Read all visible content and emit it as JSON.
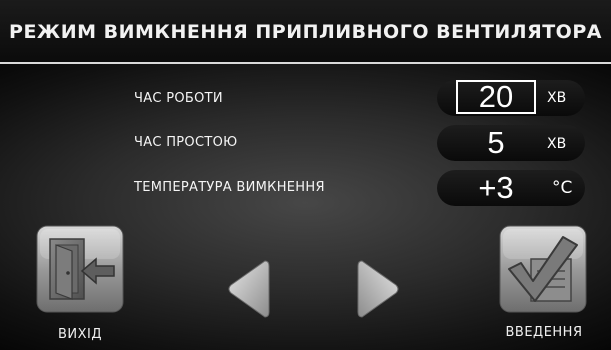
{
  "header": {
    "title": "РЕЖИМ ВИМКНЕННЯ ПРИПЛИВНОГО ВЕНТИЛЯТОРА"
  },
  "settings": [
    {
      "label": "ЧАС  РОБОТИ",
      "value": "20",
      "unit": "ХВ"
    },
    {
      "label": "ЧАС  ПРОСТОЮ",
      "value": "5",
      "unit": "ХВ"
    },
    {
      "label": "ТЕМПЕРАТУРА ВИМКНЕННЯ",
      "value": "+3",
      "unit": "°C"
    }
  ],
  "selected_field": "ЧАС  РОБОТИ",
  "buttons": {
    "exit_label": "ВИХІД",
    "enter_label": "ВВЕДЕННЯ",
    "prev_icon": "arrow-left-icon",
    "next_icon": "arrow-right-icon",
    "exit_icon": "exit-door-icon",
    "enter_icon": "checkmark-icon"
  },
  "colors": {
    "selection_border": "#ffffff",
    "text": "#f5f5f5",
    "background": "#2b2b2b"
  }
}
